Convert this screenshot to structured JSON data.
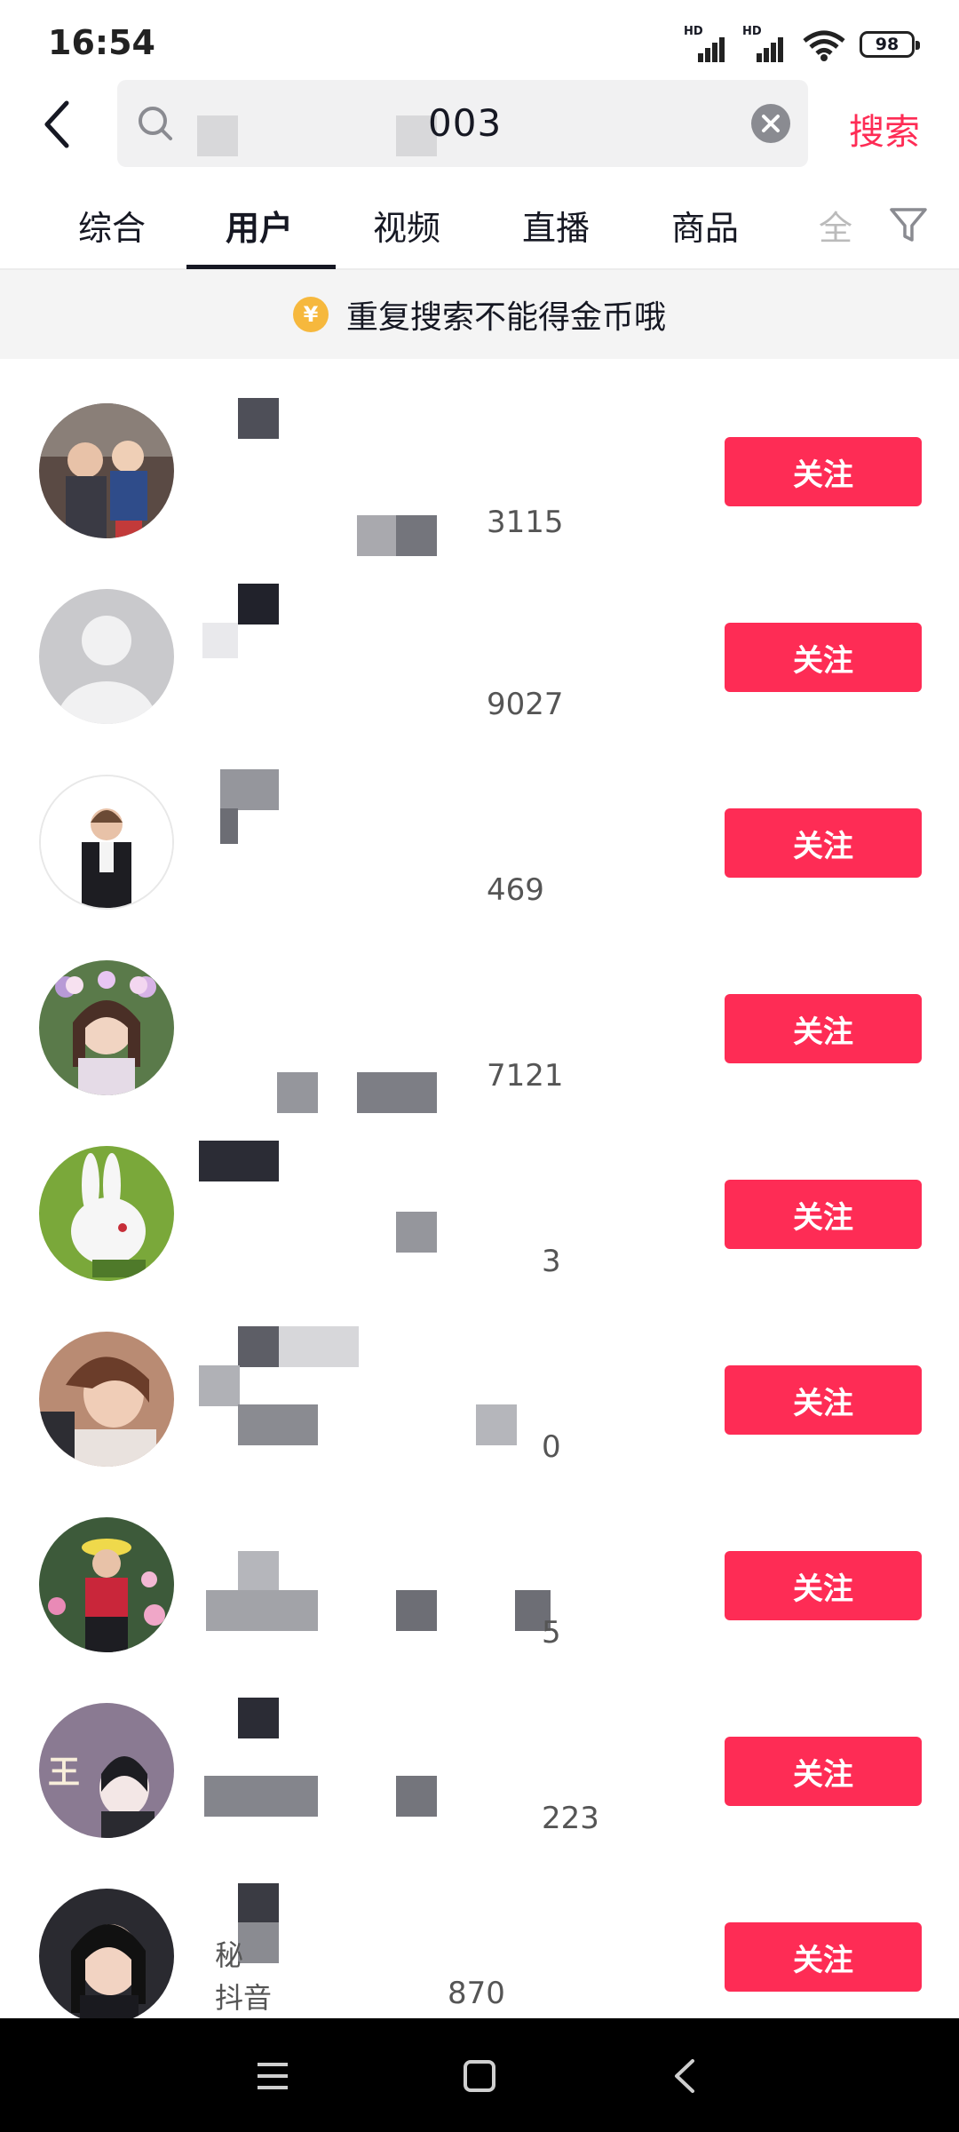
{
  "status_bar": {
    "time": "16:54",
    "network_label": "HD",
    "battery": "98"
  },
  "search": {
    "value": "003",
    "submit_label": "搜索"
  },
  "tabs": [
    {
      "label": "综合"
    },
    {
      "label": "用户"
    },
    {
      "label": "视频"
    },
    {
      "label": "直播"
    },
    {
      "label": "商品"
    },
    {
      "label": "全"
    }
  ],
  "notice": {
    "text": "重复搜索不能得金币哦",
    "coin_symbol": "¥"
  },
  "users": [
    {
      "id_partial": "3115",
      "follow_label": "关注"
    },
    {
      "id_partial": "9027",
      "follow_label": "关注"
    },
    {
      "id_partial": "469",
      "follow_label": "关注"
    },
    {
      "id_partial": "7121",
      "follow_label": "关注"
    },
    {
      "id_partial": "3",
      "follow_label": "关注"
    },
    {
      "id_partial": "0",
      "follow_label": "关注"
    },
    {
      "id_partial": "5",
      "follow_label": "关注"
    },
    {
      "id_partial": "223",
      "follow_label": "关注"
    },
    {
      "id_partial": "870",
      "follow_label": "关注",
      "name_partial": "秘",
      "id_prefix": "抖音"
    }
  ],
  "avatar_badge_text": "王",
  "colors": {
    "accent": "#fe2c55",
    "text": "#161823",
    "notice_bg": "#f4f4f4"
  }
}
